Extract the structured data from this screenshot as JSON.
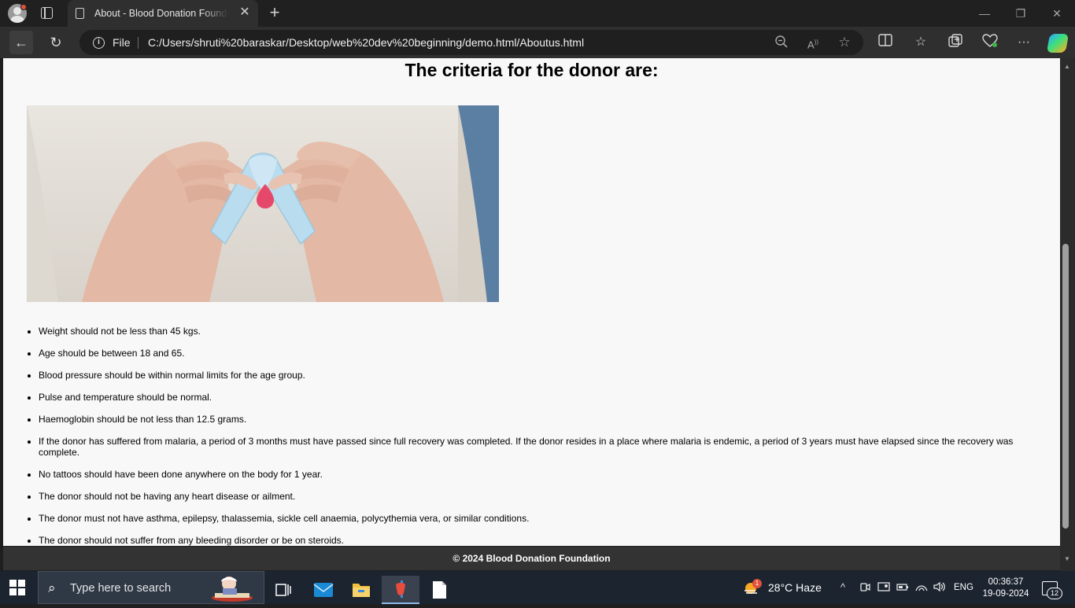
{
  "browser": {
    "tab_title": "About - Blood Donation Foundation",
    "close_tab_glyph": "✕",
    "new_tab_glyph": "+",
    "minimize_glyph": "—",
    "restore_glyph": "❐",
    "close_window_glyph": "✕",
    "back_glyph": "←",
    "refresh_glyph": "↻",
    "address": {
      "scheme_label": "File",
      "url": "C:/Users/shruti%20baraskar/Desktop/web%20dev%20beginning/demo.html/Aboutus.html",
      "icons": [
        "info-icon",
        "zoom-out-icon",
        "read-aloud-icon",
        "favorite-star-icon"
      ]
    },
    "toolbar_icons": [
      "split-screen-icon",
      "favorites-icon",
      "collections-icon",
      "browser-essentials-icon",
      "more-icon",
      "copilot-icon"
    ]
  },
  "page": {
    "heading": "The criteria for the donor are:",
    "image_subject": "hands holding awareness ribbon with blood drop",
    "criteria": [
      "Weight should not be less than 45 kgs.",
      "Age should be between 18 and 65.",
      "Blood pressure should be within normal limits for the age group.",
      "Pulse and temperature should be normal.",
      "Haemoglobin should be not less than 12.5 grams.",
      "If the donor has suffered from malaria, a period of 3 months must have passed since full recovery was completed. If the donor resides in a place where malaria is endemic, a period of 3 years must have elapsed since the recovery was complete.",
      "No tattoos should have been done anywhere on the body for 1 year.",
      "The donor should not be having any heart disease or ailment.",
      "The donor must not have asthma, epilepsy, thalassemia, sickle cell anaemia, polycythemia vera, or similar conditions.",
      "The donor should not suffer from any bleeding disorder or be on steroids."
    ],
    "footer": "© 2024 Blood Donation Foundation"
  },
  "colors": {
    "page_background": "#f8f8f8",
    "footer_background": "#333333",
    "ribbon": "#b9dcef",
    "blood_drop": "#e5486a",
    "taskbar": "#1c2430"
  },
  "taskbar": {
    "search_placeholder": "Type here to search",
    "pinned_apps": [
      "task-view-icon",
      "mail-icon",
      "file-explorer-icon",
      "app-icon",
      "notepad-icon"
    ],
    "weather_badge": "1",
    "weather": "28°C  Haze",
    "language": "ENG",
    "time": "00:36:37",
    "date": "19-09-2024",
    "notification_count": "12"
  }
}
